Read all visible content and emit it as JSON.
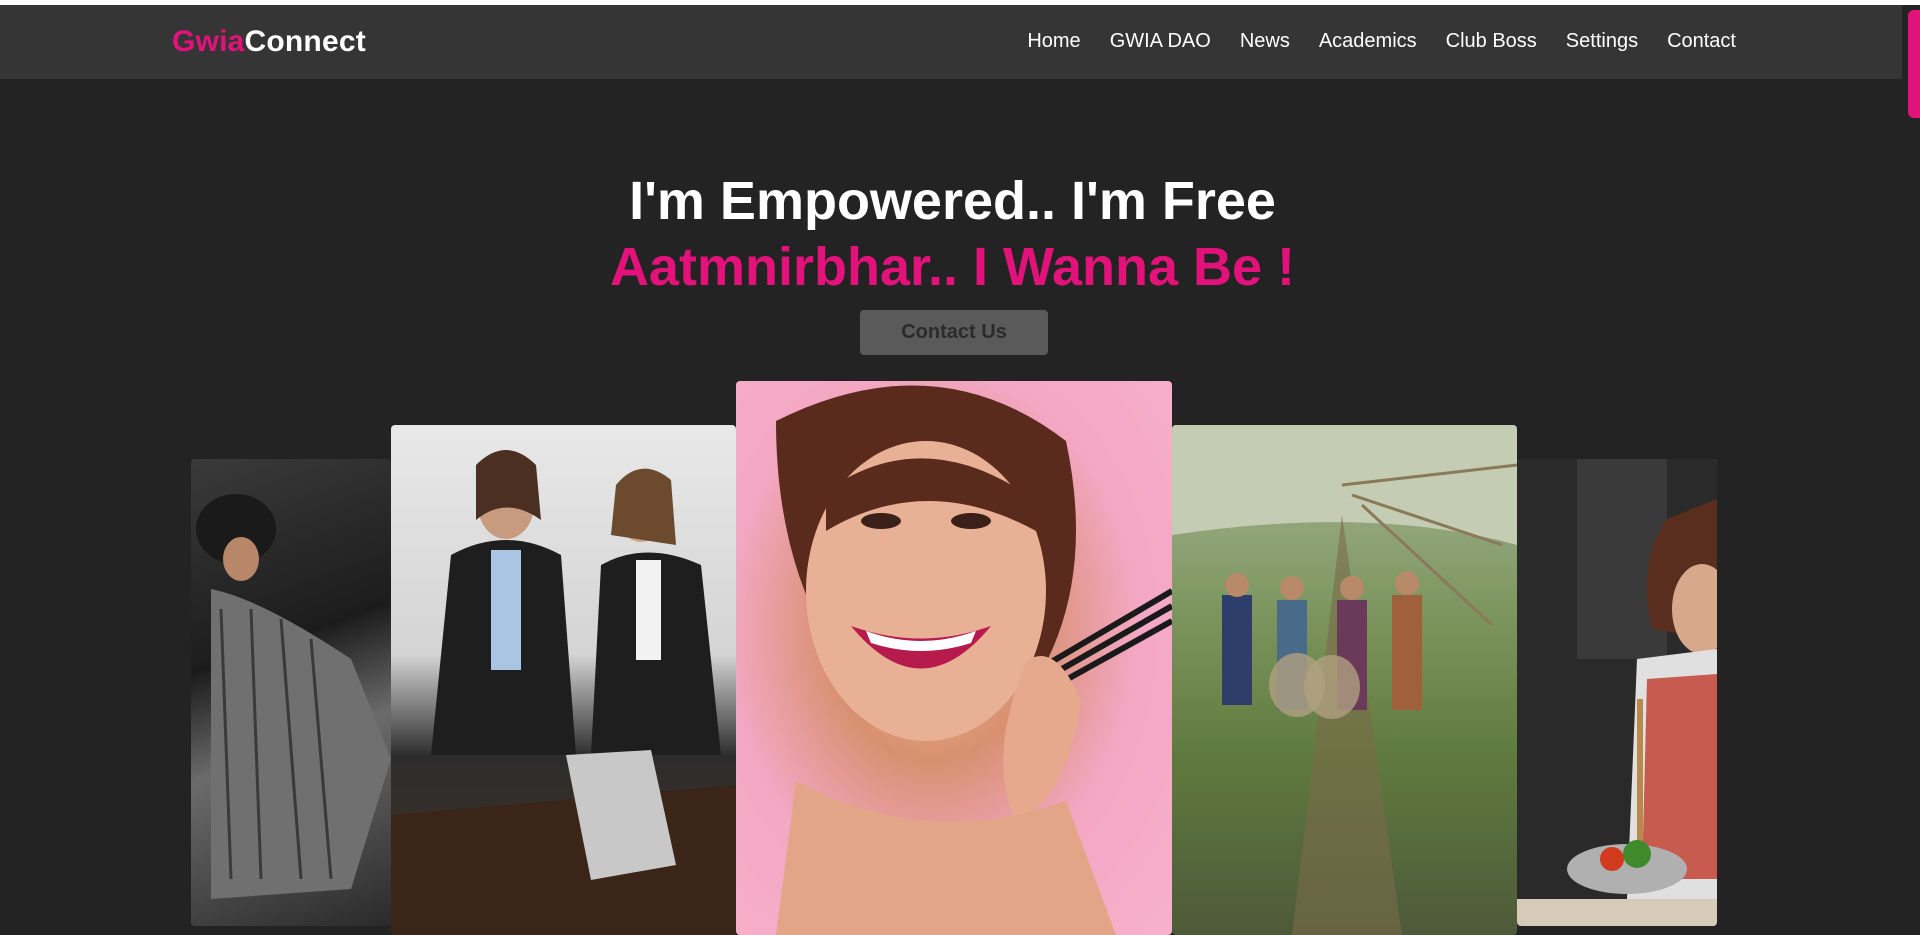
{
  "brand": {
    "part1": "Gwia",
    "part2": "Connect",
    "accent": "#e3127a"
  },
  "nav": [
    "Home",
    "GWIA DAO",
    "News",
    "Academics",
    "Club Boss",
    "Settings",
    "Contact"
  ],
  "hero": {
    "line1": "I'm Empowered.. I'm Free",
    "line2": "Aatmnirbhar.. I Wanna Be !",
    "button": "Contact Us"
  },
  "carousel": [
    {
      "name": "woman-in-striped-suit-photo"
    },
    {
      "name": "business-women-handshake-photo"
    },
    {
      "name": "smiling-woman-pink-background-photo"
    },
    {
      "name": "women-walking-rural-path-photo"
    },
    {
      "name": "woman-cooking-kitchen-photo"
    }
  ]
}
